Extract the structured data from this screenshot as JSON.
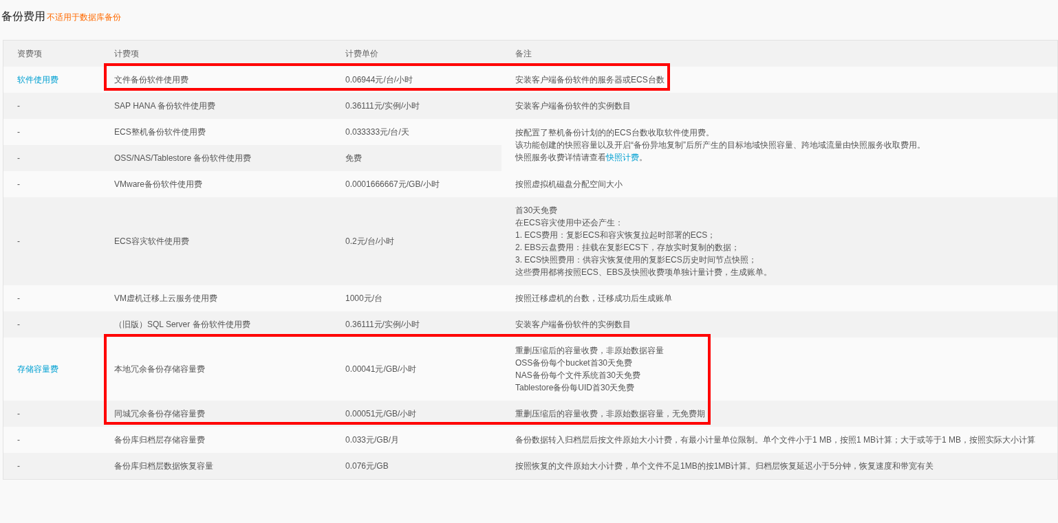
{
  "title": "备份费用",
  "subtitle": "不适用于数据库备份",
  "table": {
    "columns": [
      "资费项",
      "计费项",
      "计费单价",
      "备注"
    ],
    "rows": [
      {
        "fee_type": {
          "text": "软件使用费",
          "kind": "link"
        },
        "item": "文件备份软件使用费",
        "price": "0.06944元/台/小时",
        "note": {
          "lines": [
            "安装客户端备份软件的服务器或ECS台数"
          ]
        },
        "highlighted": true
      },
      {
        "fee_type": {
          "text": "-",
          "kind": "text"
        },
        "item": "SAP HANA 备份软件使用费",
        "price": "0.36111元/实例/小时",
        "note": {
          "lines": [
            "安装客户端备份软件的实例数目"
          ]
        },
        "highlighted": false
      },
      {
        "fee_type": {
          "text": "-",
          "kind": "text"
        },
        "item": "ECS整机备份软件使用费",
        "price": "0.033333元/台/天",
        "note": {
          "lines": [
            "按配置了整机备份计划的的ECS台数收取软件使用费。",
            "该功能创建的快照容量以及开启“备份异地复制”后所产生的目标地域快照容量、跨地域流量由快照服务收取费用。"
          ],
          "link_line": {
            "before": "快照服务收费详情请查看",
            "link": "快照计费",
            "after": "。"
          }
        },
        "highlighted": false
      },
      {
        "fee_type": {
          "text": "-",
          "kind": "text"
        },
        "item": "OSS/NAS/Tablestore 备份软件使用费",
        "price": "免费",
        "highlighted": false
      },
      {
        "fee_type": {
          "text": "-",
          "kind": "text"
        },
        "item": "VMware备份软件使用费",
        "price": "0.0001666667元/GB/小时",
        "note": {
          "lines": [
            "按照虚拟机磁盘分配空间大小"
          ]
        },
        "highlighted": false
      },
      {
        "fee_type": {
          "text": "-",
          "kind": "text"
        },
        "item": "ECS容灾软件使用费",
        "price": "0.2元/台/小时",
        "note": {
          "lines": [
            "首30天免费",
            "在ECS容灾使用中还会产生：",
            "1. ECS费用：复影ECS和容灾恢复拉起时部署的ECS；",
            "2. EBS云盘费用：挂载在复影ECS下，存放实时复制的数据；",
            "3. ECS快照费用：供容灾恢复使用的复影ECS历史时间节点快照；",
            "这些费用都将按照ECS、EBS及快照收费项单独计量计费，生成账单。"
          ]
        },
        "highlighted": false
      },
      {
        "fee_type": {
          "text": "-",
          "kind": "text"
        },
        "item": "VM虚机迁移上云服务使用费",
        "price": "1000元/台",
        "note": {
          "lines": [
            "按照迁移虚机的台数，迁移成功后生成账单"
          ]
        },
        "highlighted": false
      },
      {
        "fee_type": {
          "text": "-",
          "kind": "text"
        },
        "item": "（旧版）SQL Server 备份软件使用费",
        "price": "0.36111元/实例/小时",
        "note": {
          "lines": [
            "安装客户端备份软件的实例数目"
          ]
        },
        "highlighted": false
      },
      {
        "fee_type": {
          "text": "存储容量费",
          "kind": "link"
        },
        "item": "本地冗余备份存储容量费",
        "price": "0.00041元/GB/小时",
        "note": {
          "lines": [
            "重删压缩后的容量收费，非原始数据容量",
            "OSS备份每个bucket首30天免费",
            "NAS备份每个文件系统首30天免费",
            "Tablestore备份每UID首30天免费"
          ]
        },
        "highlighted": true
      },
      {
        "fee_type": {
          "text": "-",
          "kind": "text"
        },
        "item": "同城冗余备份存储容量费",
        "price": "0.00051元/GB/小时",
        "note": {
          "lines": [
            "重删压缩后的容量收费，非原始数据容量，无免费期"
          ]
        },
        "highlighted": true
      },
      {
        "fee_type": {
          "text": "-",
          "kind": "text"
        },
        "item": "备份库归档层存储容量费",
        "price": "0.033元/GB/月",
        "note": {
          "lines": [
            "备份数据转入归档层后按文件原始大小计费，有最小计量单位限制。单个文件小于1 MB，按照1 MB计算；大于或等于1 MB，按照实际大小计算"
          ]
        },
        "highlighted": false
      },
      {
        "fee_type": {
          "text": "-",
          "kind": "text"
        },
        "item": "备份库归档层数据恢复容量",
        "price": "0.076元/GB",
        "note": {
          "lines": [
            "按照恢复的文件原始大小计费，单个文件不足1MB的按1MB计算。归档层恢复延迟小于5分钟，恢复速度和带宽有关"
          ]
        },
        "highlighted": false
      }
    ]
  }
}
